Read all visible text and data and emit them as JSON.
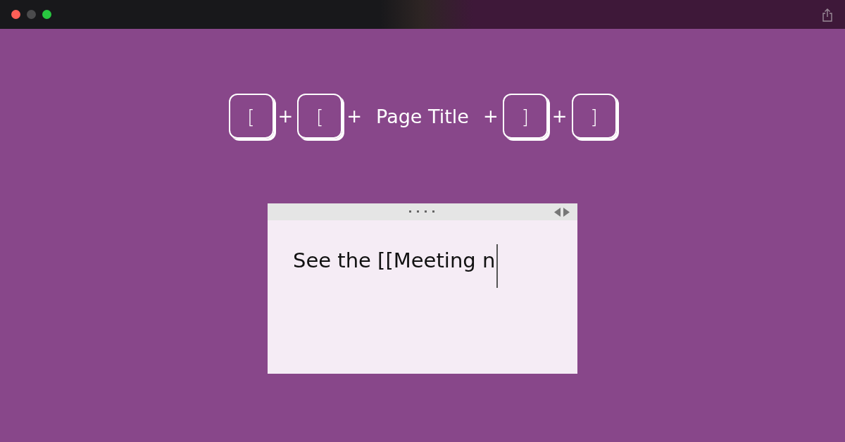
{
  "shortcut": [
    {
      "kind": "key",
      "label": "["
    },
    {
      "kind": "plus",
      "label": "+"
    },
    {
      "kind": "key",
      "label": "["
    },
    {
      "kind": "plus",
      "label": "+"
    },
    {
      "kind": "text",
      "label": "Page Title"
    },
    {
      "kind": "plus",
      "label": "+"
    },
    {
      "kind": "key",
      "label": "]"
    },
    {
      "kind": "plus",
      "label": "+"
    },
    {
      "kind": "key",
      "label": "]"
    }
  ],
  "note": {
    "text": "See the [[Meeting n"
  }
}
